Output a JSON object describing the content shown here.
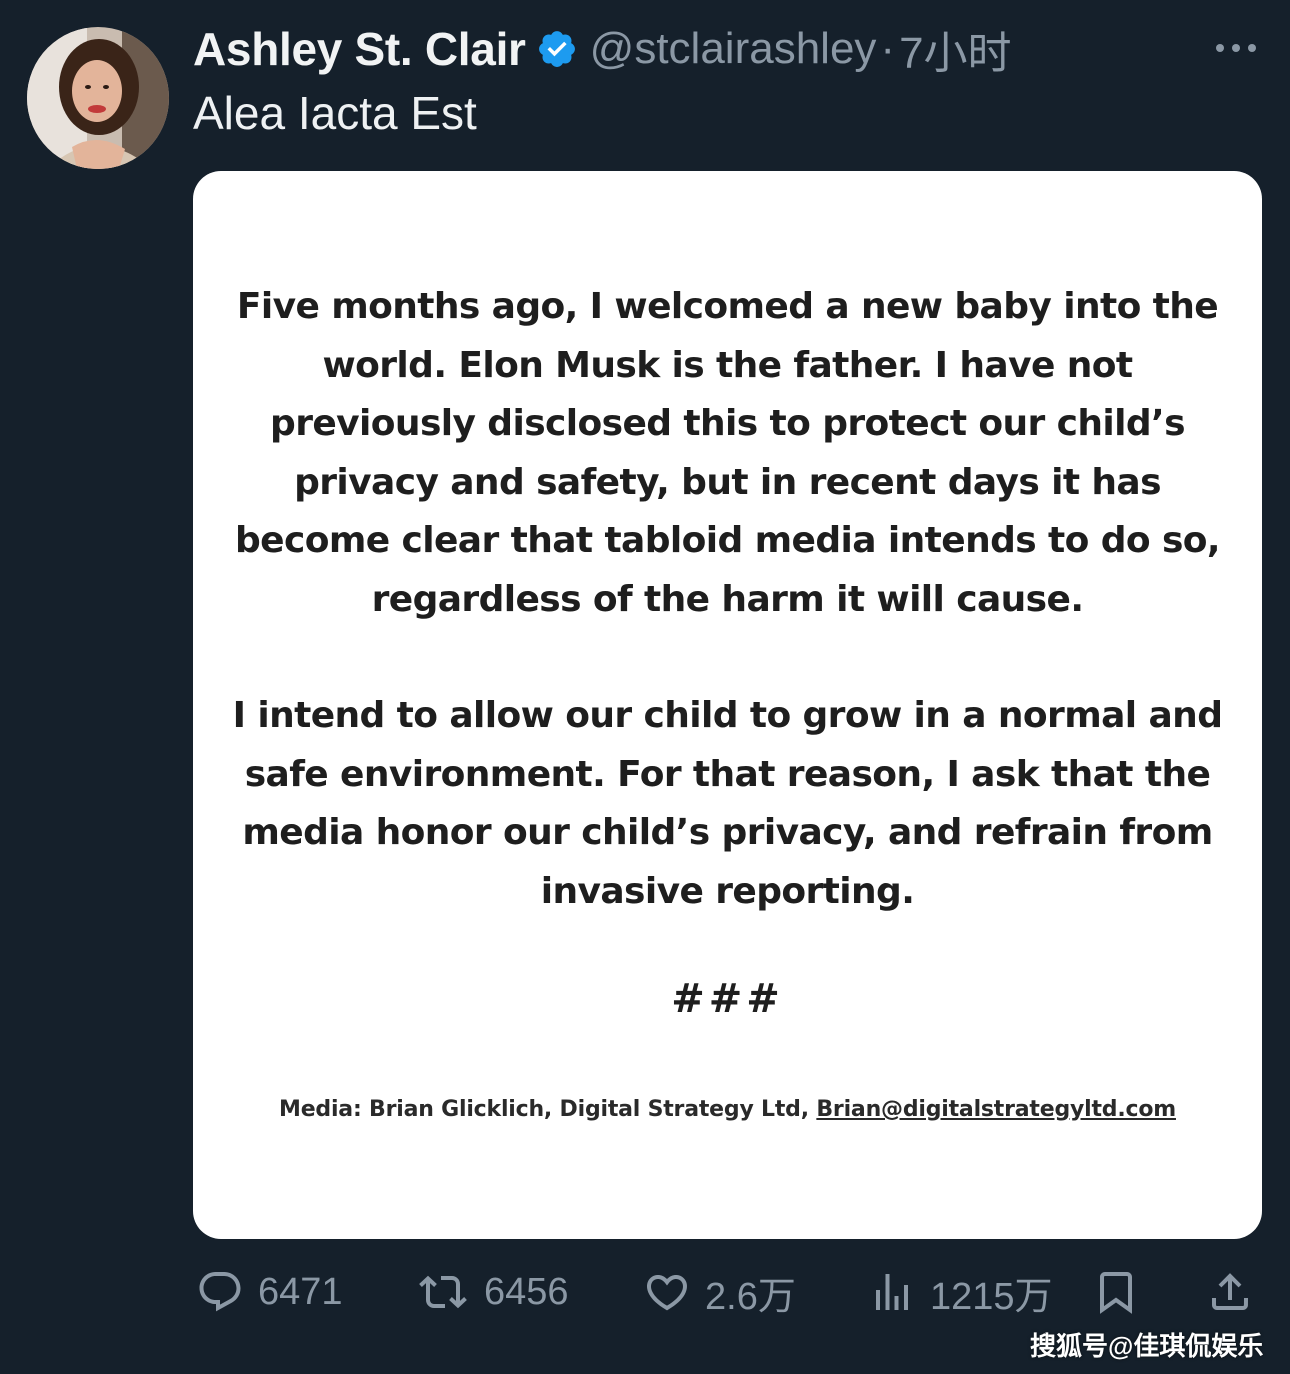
{
  "tweet": {
    "display_name": "Ashley St. Clair",
    "handle": "@stclairashley",
    "separator": "·",
    "time": "7小时",
    "text": "Alea Iacta Est",
    "verified": true
  },
  "media": {
    "paragraph1": "Five months ago, I welcomed a new baby into the world. Elon Musk is the father. I have not previously disclosed this to protect our child’s privacy and safety, but in recent days it has become clear that tabloid media intends to do so, regardless of the harm it will cause.",
    "paragraph2": "I intend to allow our child to grow in a normal and safe environment. For that reason, I ask that the media honor our child’s privacy, and refrain from invasive reporting.",
    "hashes": "###",
    "contact_prefix": "Media: Brian Glicklich, Digital Strategy Ltd,",
    "contact_email": "Brian@digitalstrategyltd.com"
  },
  "actions": {
    "replies": "6471",
    "retweets": "6456",
    "likes": "2.6万",
    "views": "1215万"
  },
  "watermark": "搜狐号@佳琪侃娱乐",
  "icons": {
    "verified": "verified-badge-icon",
    "more": "more-icon",
    "reply": "reply-icon",
    "retweet": "retweet-icon",
    "like": "heart-icon",
    "views": "views-icon",
    "bookmark": "bookmark-icon",
    "share": "share-icon"
  },
  "colors": {
    "background": "#15202b",
    "verified_blue": "#1d9bf0",
    "muted_text": "#8b98a5",
    "card_background": "#ffffff"
  }
}
